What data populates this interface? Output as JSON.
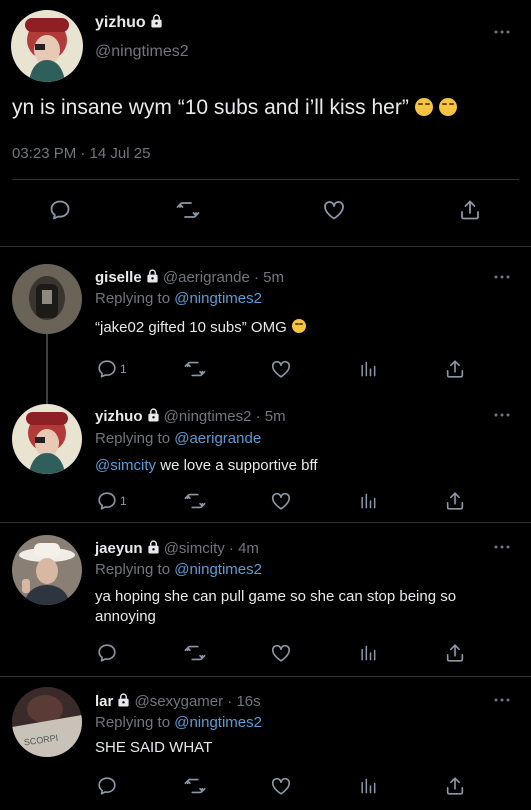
{
  "main": {
    "name": "yizhuo",
    "handle": "@ningtimes2",
    "text": "yn is insane wym “10 subs and i’ll kiss her”",
    "time": "03:23 PM · 14 Jul 25"
  },
  "replies": [
    {
      "name": "giselle",
      "handle": "@aerigrande · 5m",
      "replying_prefix": "Replying to ",
      "replying_to": "@ningtimes2",
      "text": "“jake02 gifted 10 subs” OMG",
      "reply_count": "1"
    },
    {
      "name": "yizhuo",
      "handle": "@ningtimes2 · 5m",
      "replying_prefix": "Replying to ",
      "replying_to": "@aerigrande",
      "mention": "@simcity",
      "text": " we love a supportive bff",
      "reply_count": "1"
    },
    {
      "name": "jaeyun",
      "handle": "@simcity · 4m",
      "replying_prefix": "Replying to ",
      "replying_to": "@ningtimes2",
      "text": "ya hoping she can pull game so she can stop being so annoying"
    },
    {
      "name": "lar",
      "handle": "@sexygamer · 16s",
      "replying_prefix": "Replying to ",
      "replying_to": "@ningtimes2",
      "text": "SHE SAID WHAT"
    }
  ],
  "icons": {
    "reply": "reply-icon",
    "retweet": "retweet-icon",
    "like": "heart-icon",
    "views": "views-icon",
    "share": "share-icon",
    "lock": "lock-icon",
    "more": "more-icon"
  },
  "colors": {
    "background": "#000000",
    "text": "#e7e9ea",
    "muted": "#71767b",
    "link": "#5b9bd5",
    "divider": "#2f3336"
  }
}
